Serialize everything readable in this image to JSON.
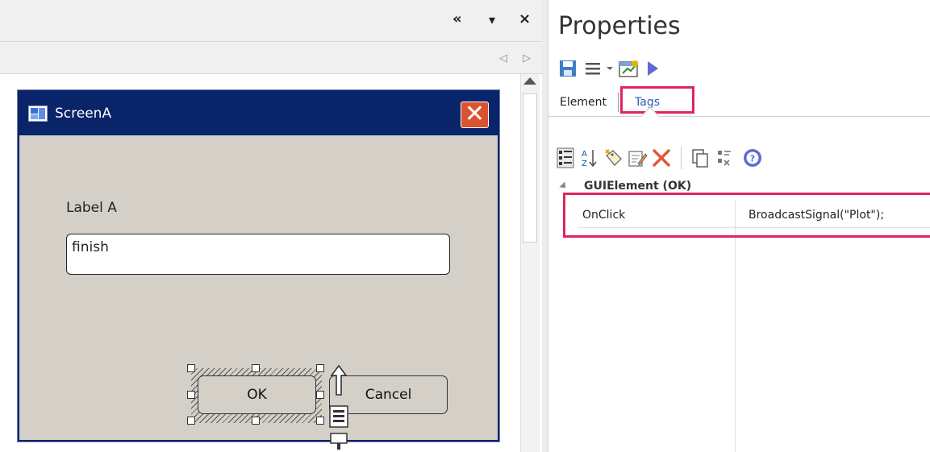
{
  "left_panel": {
    "controls": {
      "collapse_glyph": "«",
      "dropdown_glyph": "▾",
      "close_glyph": "×",
      "prev_glyph": "◁",
      "next_glyph": "▷"
    },
    "dialog": {
      "title": "ScreenA",
      "close_glyph": "✕",
      "label": "Label A",
      "field_value": "finish",
      "ok_label": "OK",
      "cancel_label": "Cancel"
    }
  },
  "properties": {
    "title": "Properties",
    "tabs": [
      {
        "label": "Element"
      },
      {
        "label": "Tags",
        "active": true
      }
    ],
    "section": {
      "name": "GUIElement (OK)",
      "rows": [
        {
          "key": "OnClick",
          "value": "BroadcastSignal(\"Plot\");"
        }
      ]
    }
  },
  "colors": {
    "highlight": "#e0255c",
    "dialog_title_bar": "#0a246a",
    "dialog_body": "#d4d0c8",
    "close_button": "#d9532f"
  }
}
